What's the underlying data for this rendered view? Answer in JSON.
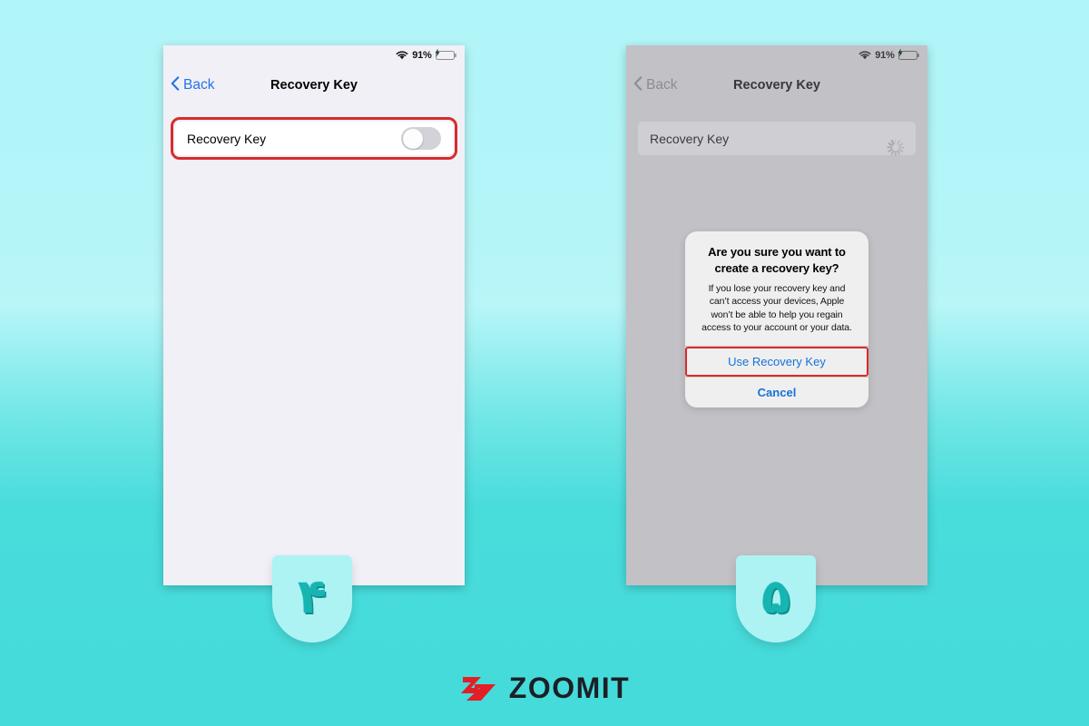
{
  "background": {
    "top_color": "#B0F5F8",
    "bottom_color": "#45DBDB"
  },
  "accent": {
    "highlight_red": "#D92B2B",
    "ios_blue": "#2472E8",
    "alert_blue": "#1572D8",
    "battery_green": "#3DD14E",
    "badge_teal": "#17B5B2"
  },
  "phones": [
    {
      "id": "phone-left",
      "state": "active",
      "statusbar": {
        "wifi_icon": "wifi-icon",
        "battery_percent": "91%",
        "battery_level": 91,
        "battery_icon": "battery-charging-icon"
      },
      "navbar": {
        "back_label": "Back",
        "back_icon": "chevron-left-icon",
        "title": "Recovery Key"
      },
      "row": {
        "label": "Recovery Key",
        "control": "toggle",
        "toggle_state": "off",
        "highlighted": true
      }
    },
    {
      "id": "phone-right",
      "state": "dimmed",
      "statusbar": {
        "wifi_icon": "wifi-icon",
        "battery_percent": "91%",
        "battery_level": 91,
        "battery_icon": "battery-charging-icon"
      },
      "navbar": {
        "back_label": "Back",
        "back_icon": "chevron-left-icon",
        "title": "Recovery Key"
      },
      "row": {
        "label": "Recovery Key",
        "control": "spinner",
        "spinner_icon": "loading-spinner-icon",
        "highlighted": false
      },
      "alert": {
        "title": "Are you sure you want to create a recovery key?",
        "message": "If you lose your recovery key and can’t access your devices, Apple won’t be able to help you regain access to your account or your data.",
        "primary_button": "Use Recovery Key",
        "primary_highlighted": true,
        "secondary_button": "Cancel"
      }
    }
  ],
  "badges": [
    {
      "number": "۴",
      "step": 4
    },
    {
      "number": "۵",
      "step": 5
    }
  ],
  "watermark": {
    "mark_icon": "zoomit-z-mark-icon",
    "text": "ZOOMIT",
    "mark_color": "#E31E26",
    "text_color": "#1C2026"
  }
}
